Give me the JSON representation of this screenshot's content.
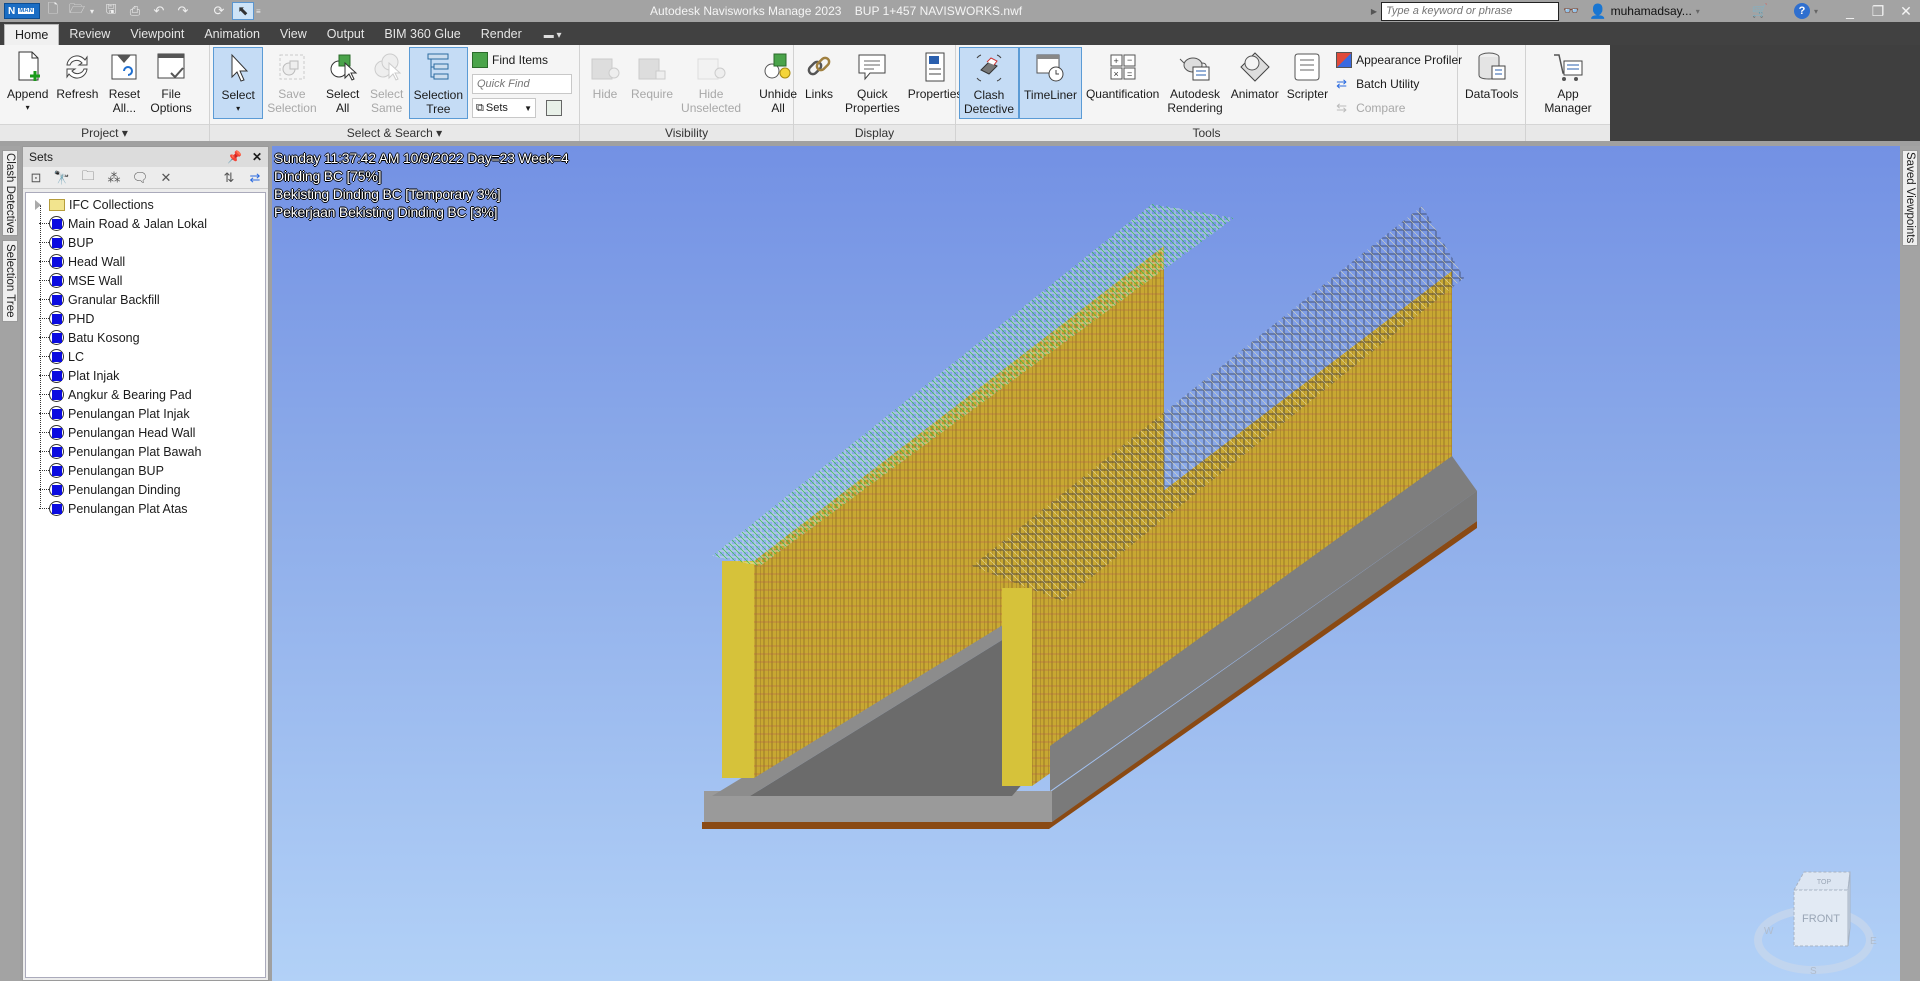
{
  "titlebar": {
    "app_title": "Autodesk Navisworks Manage 2023",
    "file_name": "BUP 1+457 NAVISWORKS.nwf",
    "logo_text": "N",
    "logo_badge": "MAN",
    "search_placeholder": "Type a keyword or phrase",
    "username": "muhamadsay...",
    "help_label": "?"
  },
  "tabs": [
    {
      "label": "Home",
      "active": true
    },
    {
      "label": "Review"
    },
    {
      "label": "Viewpoint"
    },
    {
      "label": "Animation"
    },
    {
      "label": "View"
    },
    {
      "label": "Output"
    },
    {
      "label": "BIM 360 Glue"
    },
    {
      "label": "Render"
    }
  ],
  "ribbon": {
    "project": {
      "label": "Project ▾",
      "buttons": [
        {
          "line1": "Append",
          "line2": "▾"
        },
        {
          "line1": "Refresh",
          "line2": ""
        },
        {
          "line1": "Reset",
          "line2": "All..."
        },
        {
          "line1": "File",
          "line2": "Options"
        }
      ]
    },
    "select_search": {
      "label": "Select & Search ▾",
      "select": {
        "line1": "Select",
        "line2": "▾"
      },
      "save_selection": {
        "line1": "Save",
        "line2": "Selection"
      },
      "select_all": {
        "line1": "Select",
        "line2": "All"
      },
      "select_same": {
        "line1": "Select",
        "line2": "Same"
      },
      "selection_tree": {
        "line1": "Selection",
        "line2": "Tree"
      },
      "find_items": "Find Items",
      "quick_find_placeholder": "Quick Find",
      "sets_dropdown": "Sets"
    },
    "visibility": {
      "label": "Visibility",
      "buttons": [
        {
          "line1": "Hide",
          "line2": ""
        },
        {
          "line1": "Require",
          "line2": ""
        },
        {
          "line1": "Hide",
          "line2": "Unselected"
        },
        {
          "line1": "Unhide",
          "line2": "All"
        }
      ]
    },
    "display": {
      "label": "Display",
      "buttons": [
        {
          "line1": "Links",
          "line2": ""
        },
        {
          "line1": "Quick",
          "line2": "Properties"
        },
        {
          "line1": "Properties",
          "line2": ""
        }
      ]
    },
    "tools": {
      "label": "Tools",
      "clash": {
        "line1": "Clash",
        "line2": "Detective"
      },
      "timeliner": {
        "line1": "TimeLiner",
        "line2": ""
      },
      "quantification": {
        "line1": "Quantification",
        "line2": ""
      },
      "rendering": {
        "line1": "Autodesk",
        "line2": "Rendering"
      },
      "animator": {
        "line1": "Animator",
        "line2": ""
      },
      "scripter": {
        "line1": "Scripter",
        "line2": ""
      },
      "appearance_profiler": "Appearance Profiler",
      "batch_utility": "Batch Utility",
      "compare": "Compare"
    },
    "datatools": {
      "line1": "DataTools",
      "line2": ""
    },
    "app_manager": {
      "line1": "App Manager",
      "line2": ""
    }
  },
  "left_dock": {
    "tabs": [
      "Clash Detective",
      "Selection Tree"
    ]
  },
  "right_dock": {
    "tabs": [
      "Saved Viewpoints"
    ]
  },
  "sets_panel": {
    "title": "Sets",
    "tree": [
      {
        "label": "IFC Collections",
        "type": "folder"
      },
      {
        "label": "Main Road & Jalan Lokal",
        "type": "set"
      },
      {
        "label": "BUP",
        "type": "set"
      },
      {
        "label": "Head Wall",
        "type": "set"
      },
      {
        "label": "MSE Wall",
        "type": "set"
      },
      {
        "label": "Granular Backfill",
        "type": "set"
      },
      {
        "label": "PHD",
        "type": "set"
      },
      {
        "label": "Batu Kosong",
        "type": "set"
      },
      {
        "label": "LC",
        "type": "set"
      },
      {
        "label": "Plat Injak",
        "type": "set"
      },
      {
        "label": "Angkur & Bearing Pad",
        "type": "set"
      },
      {
        "label": "Penulangan Plat Injak",
        "type": "set"
      },
      {
        "label": "Penulangan Head Wall",
        "type": "set"
      },
      {
        "label": "Penulangan Plat Bawah",
        "type": "set"
      },
      {
        "label": "Penulangan BUP",
        "type": "set"
      },
      {
        "label": "Penulangan Dinding",
        "type": "set"
      },
      {
        "label": "Penulangan Plat Atas",
        "type": "set"
      }
    ]
  },
  "viewport": {
    "overlay_lines": [
      "Sunday 11:37:42 AM 10/9/2022 Day=23 Week=4",
      "Dinding BC [75%]",
      "Bekisting Dinding BC [Temporary 3%]",
      "Pekerjaan Bekisting Dinding BC [3%]"
    ],
    "viewcube": {
      "top": "TOP",
      "front": "FRONT",
      "w": "W",
      "e": "E",
      "s": "S"
    }
  }
}
